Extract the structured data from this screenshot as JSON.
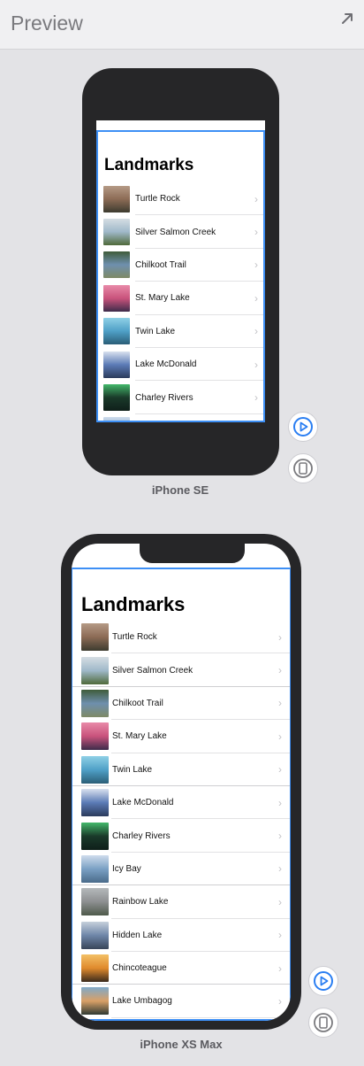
{
  "panel": {
    "title": "Preview"
  },
  "devices": {
    "se": {
      "label": "iPhone SE"
    },
    "xs": {
      "label": "iPhone XS Max"
    }
  },
  "app": {
    "nav_title": "Landmarks"
  },
  "landmarks": [
    {
      "name": "Turtle Rock",
      "thumb": [
        "#8c6b55",
        "#b59a86",
        "#3d3b2f"
      ]
    },
    {
      "name": "Silver Salmon Creek",
      "thumb": [
        "#9fb8c9",
        "#d5dde3",
        "#4f6a3a"
      ]
    },
    {
      "name": "Chilkoot Trail",
      "thumb": [
        "#6e8fae",
        "#3f5c3a",
        "#7e8a66"
      ]
    },
    {
      "name": "St. Mary Lake",
      "thumb": [
        "#c9537c",
        "#e88aa8",
        "#3d2b4a"
      ]
    },
    {
      "name": "Twin Lake",
      "thumb": [
        "#4fa0c7",
        "#8fd0e6",
        "#2a5e77"
      ]
    },
    {
      "name": "Lake McDonald",
      "thumb": [
        "#5b7bb6",
        "#d8e0ee",
        "#2b3b5c"
      ]
    },
    {
      "name": "Charley Rivers",
      "thumb": [
        "#1a3a2a",
        "#43b86a",
        "#0f1f1a"
      ]
    },
    {
      "name": "Icy Bay",
      "thumb": [
        "#7aa0c4",
        "#cfdcec",
        "#4a6b8a"
      ]
    },
    {
      "name": "Rainbow Lake",
      "thumb": [
        "#8d8f91",
        "#b5b9bb",
        "#4f5a4b"
      ]
    },
    {
      "name": "Hidden Lake",
      "thumb": [
        "#6e86a8",
        "#c6d0db",
        "#38455a"
      ]
    },
    {
      "name": "Chincoteague",
      "thumb": [
        "#e08a2d",
        "#f3c066",
        "#3a2a1c"
      ]
    },
    {
      "name": "Lake Umbagog",
      "thumb": [
        "#d9a067",
        "#7fa9c9",
        "#2f3a33"
      ]
    }
  ],
  "colors": {
    "selection": "#3d8ff5",
    "accent": "#2a7ef2"
  },
  "icons": {
    "expand": "expand-arrow-icon",
    "play": "live-preview-play-icon",
    "device": "device-preview-icon"
  }
}
